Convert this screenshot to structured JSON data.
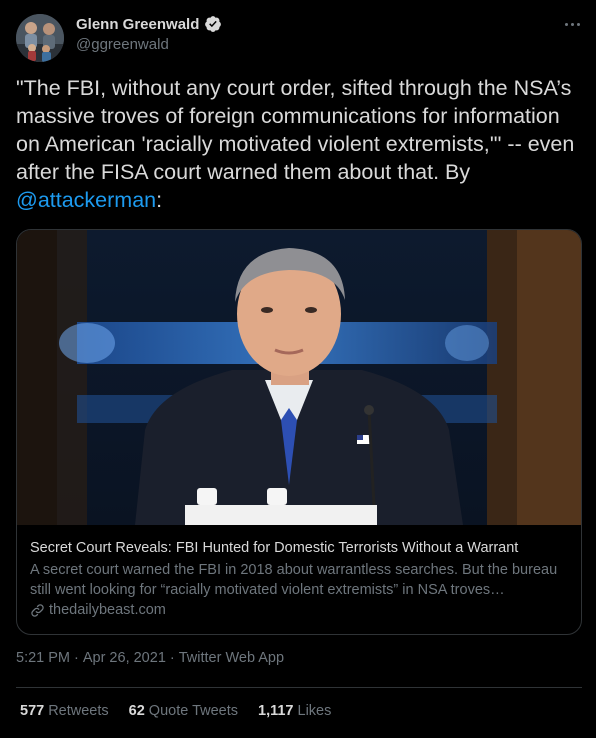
{
  "author": {
    "display_name": "Glenn Greenwald",
    "handle": "@ggreenwald",
    "verified": true,
    "avatar_icon": "avatar-photo"
  },
  "tweet": {
    "text_before": "\"The FBI, without any court order, sifted through the NSA’s massive troves of foreign communications for information on American 'racially motivated violent extremists,'\" -- even after the FISA court warned them about that. By ",
    "mention": "@attackerman",
    "text_after": ":"
  },
  "card": {
    "image_icon": "article-photo",
    "title": "Secret Court Reveals: FBI Hunted for Domestic Terrorists Without a Warrant",
    "description": "A secret court warned the FBI in 2018 about warrantless searches. But the bureau still went looking for “racially motivated violent extremists” in NSA troves…",
    "domain": "thedailybeast.com",
    "domain_icon": "link-icon"
  },
  "meta": {
    "time": "5:21 PM",
    "separator1": "·",
    "date": "Apr 26, 2021",
    "separator2": "·",
    "source": "Twitter Web App"
  },
  "stats": {
    "retweets_count": "577",
    "retweets_label": "Retweets",
    "quotes_count": "62",
    "quotes_label": "Quote Tweets",
    "likes_count": "1,117",
    "likes_label": "Likes"
  },
  "colors": {
    "background": "#000000",
    "text_primary": "#d9d9d9",
    "text_secondary": "#6e767d",
    "accent": "#1d9bf0",
    "border": "#2f3336"
  }
}
